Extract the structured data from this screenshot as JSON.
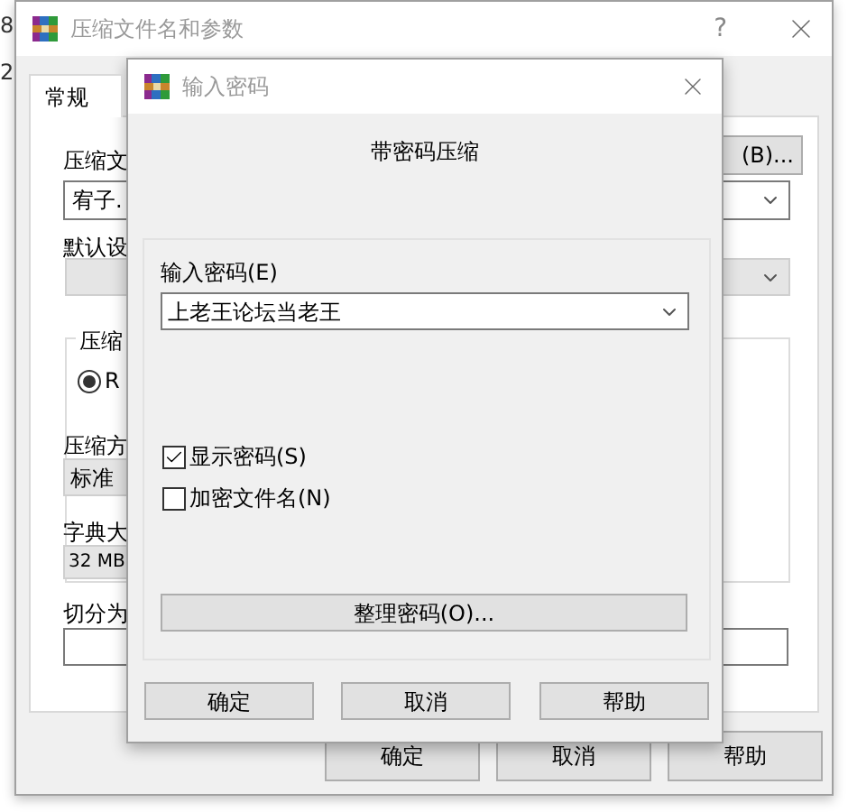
{
  "desktop_edge": [
    "8",
    "2"
  ],
  "back_window": {
    "title": "压缩文件名和参数",
    "help": "?",
    "tabs": [
      {
        "label": "常规",
        "selected": true
      }
    ],
    "archive_label": "压缩文",
    "browse_button": "(B)...",
    "archive_name": "宥子.",
    "profile_label": "默认设",
    "format_group": "压缩",
    "format_option": {
      "label": "R",
      "selected": true
    },
    "method_label": "压缩方",
    "method_value": "标准",
    "dict_label": "字典大",
    "dict_value": "32 MB",
    "split_label": "切分为",
    "buttons": [
      "确定",
      "取消",
      "帮助"
    ]
  },
  "dialog": {
    "title": "输入密码",
    "heading": "带密码压缩",
    "password_label": "输入密码(E)",
    "password": "上老王论坛当老王",
    "options": [
      {
        "label": "显示密码(S)",
        "checked": true
      },
      {
        "label": "加密文件名(N)",
        "checked": false
      }
    ],
    "organize_button": "整理密码(O)...",
    "buttons": [
      "确定",
      "取消",
      "帮助"
    ]
  }
}
